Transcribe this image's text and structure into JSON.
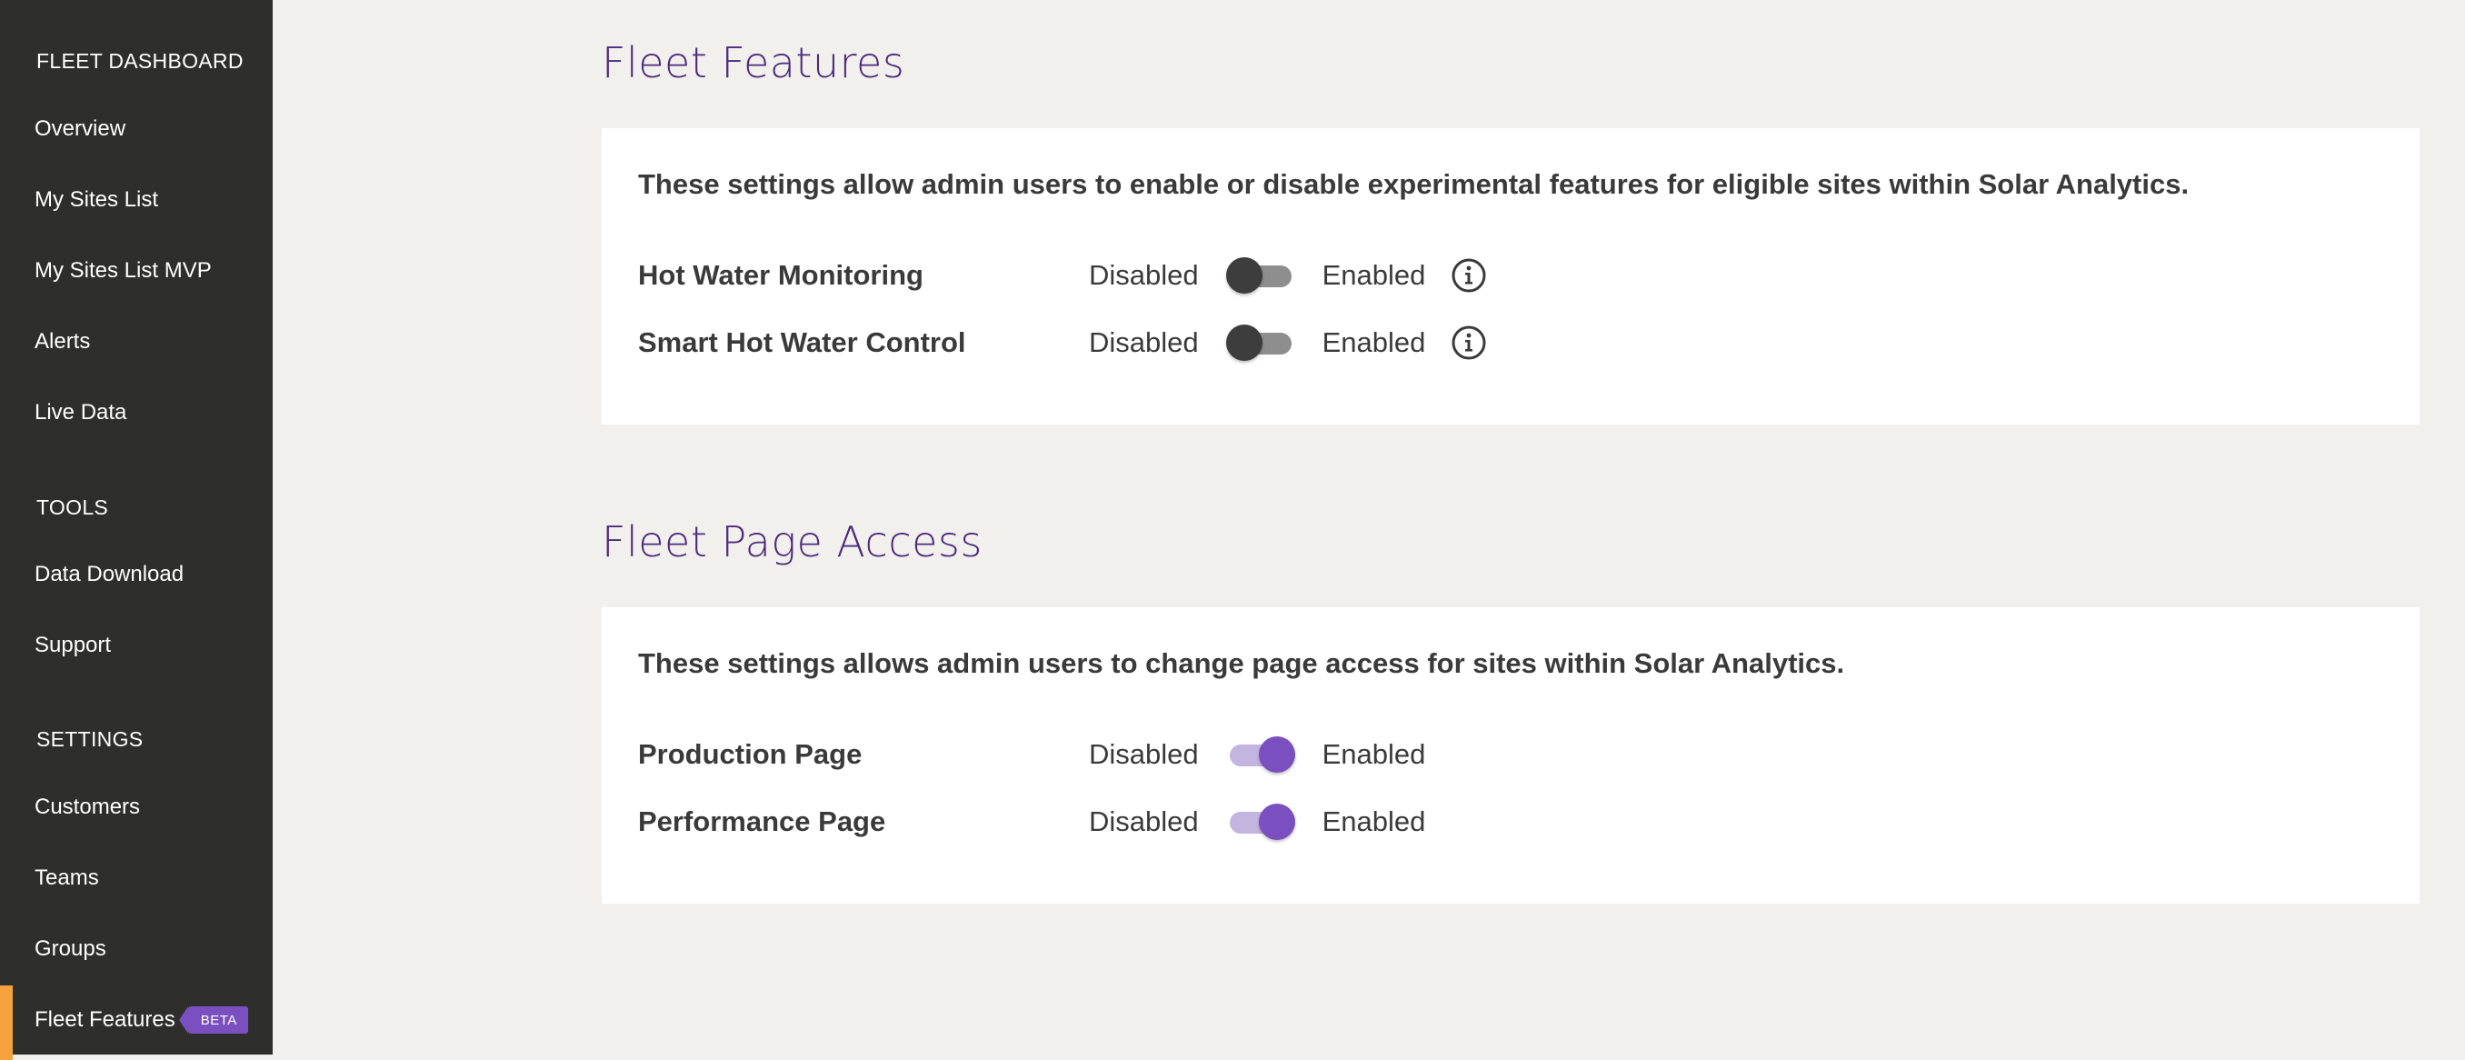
{
  "sidebar": {
    "sections": {
      "fleet_dashboard": "FLEET DASHBOARD",
      "tools": "TOOLS",
      "settings": "SETTINGS"
    },
    "dashboard_items": [
      "Overview",
      "My Sites List",
      "My Sites List MVP",
      "Alerts",
      "Live Data"
    ],
    "tool_items": [
      "Data Download",
      "Support"
    ],
    "settings_items": [
      "Customers",
      "Teams",
      "Groups",
      "Fleet Features"
    ],
    "active_item": "Fleet Features",
    "badge": "BETA"
  },
  "fleet_features": {
    "title": "Fleet Features",
    "description": "These settings allow admin users to enable or disable experimental features for eligible sites within Solar Analytics.",
    "rows": [
      {
        "label": "Hot Water Monitoring",
        "off_label": "Disabled",
        "on_label": "Enabled",
        "enabled": false,
        "has_info": true
      },
      {
        "label": "Smart Hot Water Control",
        "off_label": "Disabled",
        "on_label": "Enabled",
        "enabled": false,
        "has_info": true
      }
    ]
  },
  "fleet_page_access": {
    "title": "Fleet Page Access",
    "description": "These settings allows admin users to change page access for sites within Solar Analytics.",
    "rows": [
      {
        "label": "Production Page",
        "off_label": "Disabled",
        "on_label": "Enabled",
        "enabled": true,
        "has_info": false
      },
      {
        "label": "Performance Page",
        "off_label": "Disabled",
        "on_label": "Enabled",
        "enabled": true,
        "has_info": false
      }
    ]
  },
  "colors": {
    "sidebar_bg": "#2e2e2d",
    "accent_active": "#f5a23b",
    "brand_purple": "#7a4fc0",
    "title_purple": "#4b2a7e",
    "page_bg": "#f1f0ec"
  },
  "icons": {
    "info": "info-circle-icon"
  }
}
